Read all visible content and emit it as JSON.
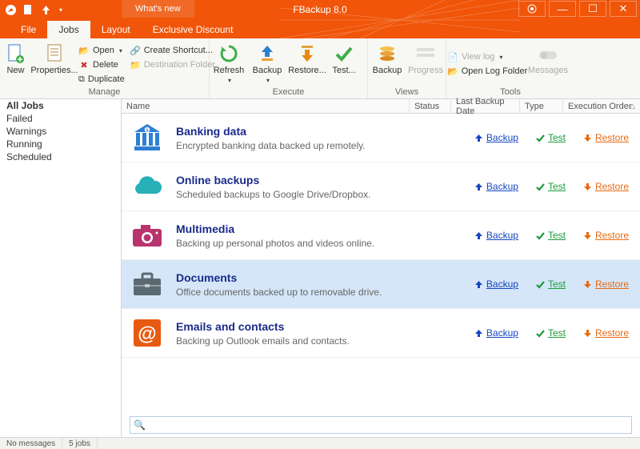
{
  "titlebar": {
    "app_title": "FBackup 8.0",
    "whats_new": "What's new"
  },
  "tabs": {
    "file": "File",
    "jobs": "Jobs",
    "layout": "Layout",
    "exclusive": "Exclusive Discount"
  },
  "ribbon": {
    "manage": {
      "label": "Manage",
      "new": "New",
      "properties": "Properties...",
      "open": "Open",
      "delete": "Delete",
      "duplicate": "Duplicate",
      "create_shortcut": "Create Shortcut...",
      "destination_folder": "Destination Folder"
    },
    "execute": {
      "label": "Execute",
      "refresh": "Refresh",
      "backup": "Backup",
      "restore": "Restore...",
      "test": "Test..."
    },
    "views": {
      "label": "Views",
      "backup": "Backup",
      "progress": "Progress"
    },
    "tools": {
      "label": "Tools",
      "view_log": "View log",
      "open_log_folder": "Open Log Folder",
      "messages": "Messages"
    }
  },
  "sidebar": {
    "items": [
      "All Jobs",
      "Failed",
      "Warnings",
      "Running",
      "Scheduled"
    ]
  },
  "columns": {
    "name": "Name",
    "status": "Status",
    "last_backup_date": "Last Backup Date",
    "type": "Type",
    "execution_order": "Execution Order"
  },
  "actions": {
    "backup": "Backup",
    "test": "Test",
    "restore": "Restore"
  },
  "jobs": [
    {
      "title": "Banking data",
      "desc": "Encrypted banking data backed up remotely.",
      "icon": "bank",
      "color": "#2d7fd3"
    },
    {
      "title": "Online backups",
      "desc": "Scheduled backups to Google Drive/Dropbox.",
      "icon": "cloud",
      "color": "#28b0b8"
    },
    {
      "title": "Multimedia",
      "desc": "Backing up personal photos and videos online.",
      "icon": "camera",
      "color": "#b9336e"
    },
    {
      "title": "Documents",
      "desc": "Office documents backed up to removable drive.",
      "icon": "briefcase",
      "color": "#5b6a72",
      "selected": true
    },
    {
      "title": "Emails and contacts",
      "desc": "Backing up Outlook emails and contacts.",
      "icon": "at",
      "color": "#e85a12"
    }
  ],
  "search_placeholder": "",
  "statusbar": {
    "messages": "No messages",
    "jobs": "5 jobs"
  }
}
